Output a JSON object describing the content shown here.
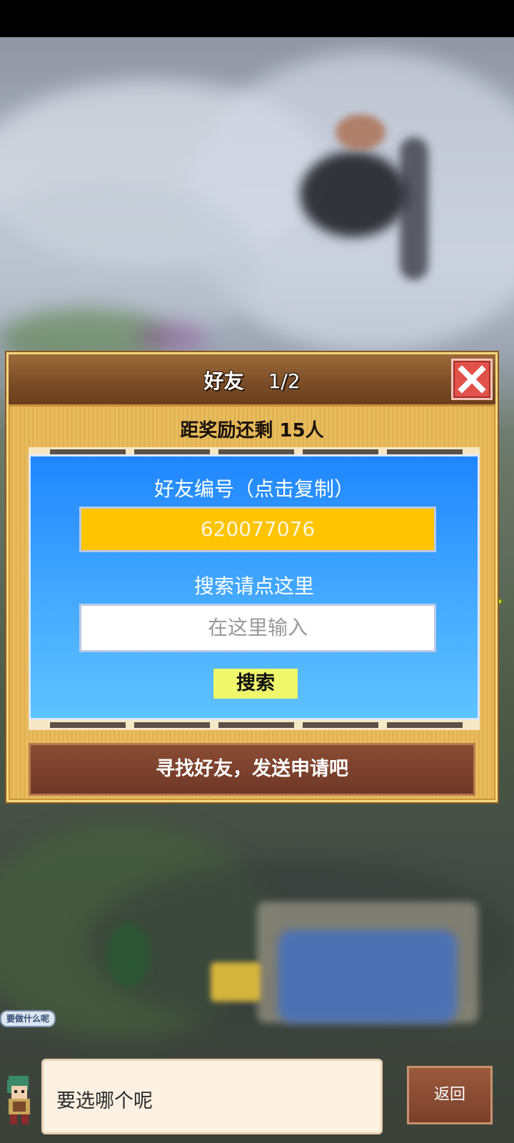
{
  "dialog": {
    "title": "好友",
    "page": "1/2",
    "reward_text": "距奖励还剩 15人",
    "friend_id_label": "好友编号（点击复制）",
    "friend_id": "620077076",
    "search_label": "搜索请点这里",
    "search_placeholder": "在这里输入",
    "search_button": "搜索",
    "footer_text": "寻找好友，发送申请吧"
  },
  "hud": {
    "small_bubble": "要做什么呢",
    "message": "要选哪个呢",
    "back_button": "返回"
  },
  "colors": {
    "dialog_bg": "#e8b956",
    "panel_blue": "#1f86ff",
    "friend_id_bg": "#ffc400",
    "search_button_bg": "#eff86a",
    "close_red": "#e0524a"
  }
}
